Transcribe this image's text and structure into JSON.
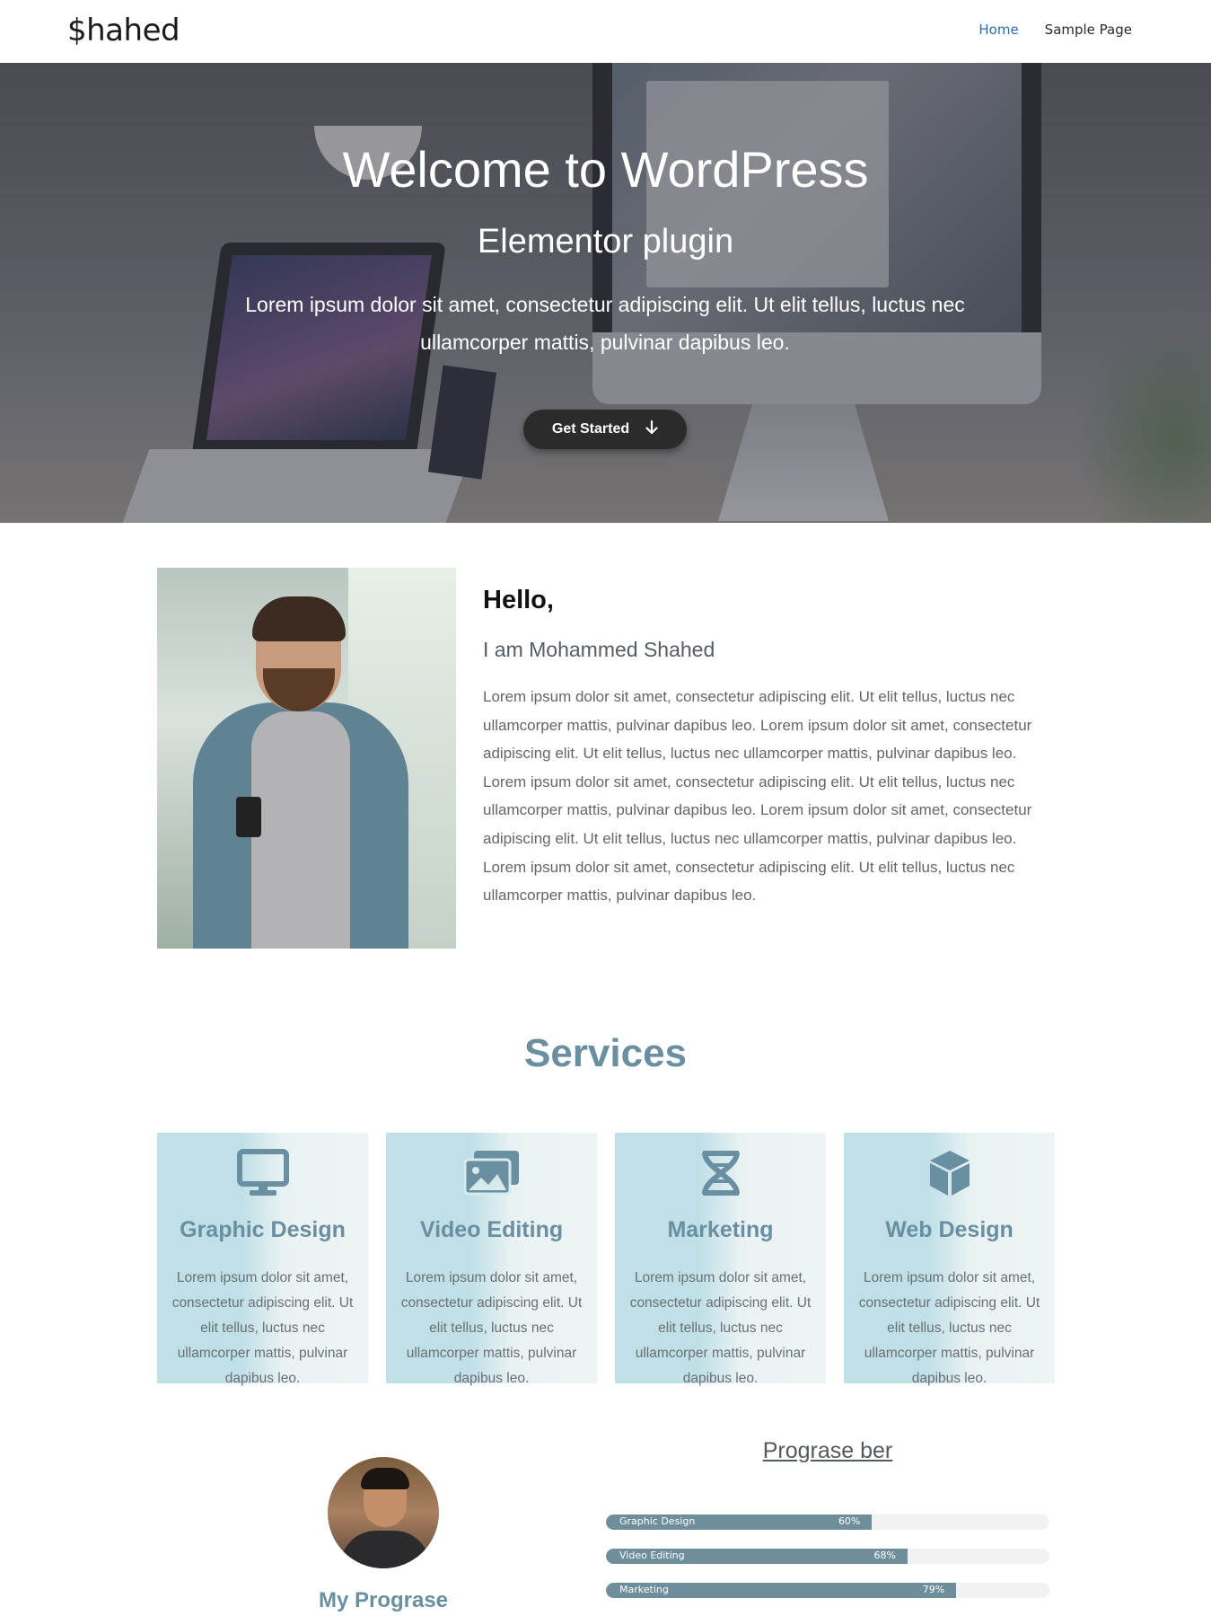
{
  "header": {
    "site_title": "$hahed",
    "nav": [
      {
        "label": "Home",
        "active": true
      },
      {
        "label": "Sample Page",
        "active": false
      }
    ]
  },
  "hero": {
    "title": "Welcome to WordPress",
    "subtitle": "Elementor plugin",
    "text": "Lorem ipsum dolor sit amet, consectetur adipiscing elit. Ut elit tellus, luctus nec ullamcorper mattis, pulvinar dapibus leo.",
    "button_label": "Get Started",
    "button_icon": "arrow-down-icon"
  },
  "about": {
    "greeting": "Hello,",
    "name_line": "I am Mohammed Shahed",
    "body": "Lorem ipsum dolor sit amet, consectetur adipiscing elit. Ut elit tellus, luctus nec ullamcorper mattis, pulvinar dapibus leo. Lorem ipsum dolor sit amet, consectetur adipiscing elit. Ut elit tellus, luctus nec ullamcorper mattis, pulvinar dapibus leo. Lorem ipsum dolor sit amet, consectetur adipiscing elit. Ut elit tellus, luctus nec ullamcorper mattis, pulvinar dapibus leo. Lorem ipsum dolor sit amet, consectetur adipiscing elit. Ut elit tellus, luctus nec ullamcorper mattis, pulvinar dapibus leo. Lorem ipsum dolor sit amet, consectetur adipiscing elit. Ut elit tellus, luctus nec ullamcorper mattis, pulvinar dapibus leo."
  },
  "services": {
    "title": "Services",
    "items": [
      {
        "title": "Graphic Design",
        "icon": "desktop-icon",
        "text": "Lorem ipsum dolor sit amet, consectetur adipiscing elit. Ut elit tellus, luctus nec ullamcorper mattis, pulvinar dapibus leo."
      },
      {
        "title": "Video Editing",
        "icon": "images-icon",
        "text": "Lorem ipsum dolor sit amet, consectetur adipiscing elit. Ut elit tellus, luctus nec ullamcorper mattis, pulvinar dapibus leo."
      },
      {
        "title": "Marketing",
        "icon": "dna-icon",
        "text": "Lorem ipsum dolor sit amet, consectetur adipiscing elit. Ut elit tellus, luctus nec ullamcorper mattis, pulvinar dapibus leo."
      },
      {
        "title": "Web Design",
        "icon": "cube-icon",
        "text": "Lorem ipsum dolor sit amet, consectetur adipiscing elit. Ut elit tellus, luctus nec ullamcorper mattis, pulvinar dapibus leo."
      }
    ]
  },
  "progress": {
    "profile_title": "My Prograse",
    "bars_title": "Prograse ber",
    "bars": [
      {
        "label": "Graphic Design",
        "value": 60,
        "value_label": "60%"
      },
      {
        "label": "Video Editing",
        "value": 68,
        "value_label": "68%"
      },
      {
        "label": "Marketing",
        "value": 79,
        "value_label": "79%"
      }
    ]
  },
  "colors": {
    "accent": "#6a8fa1",
    "nav_active": "#2b6cb0",
    "card_bg": "#bfe0e7",
    "bar_fill": "#6f8e9c"
  }
}
